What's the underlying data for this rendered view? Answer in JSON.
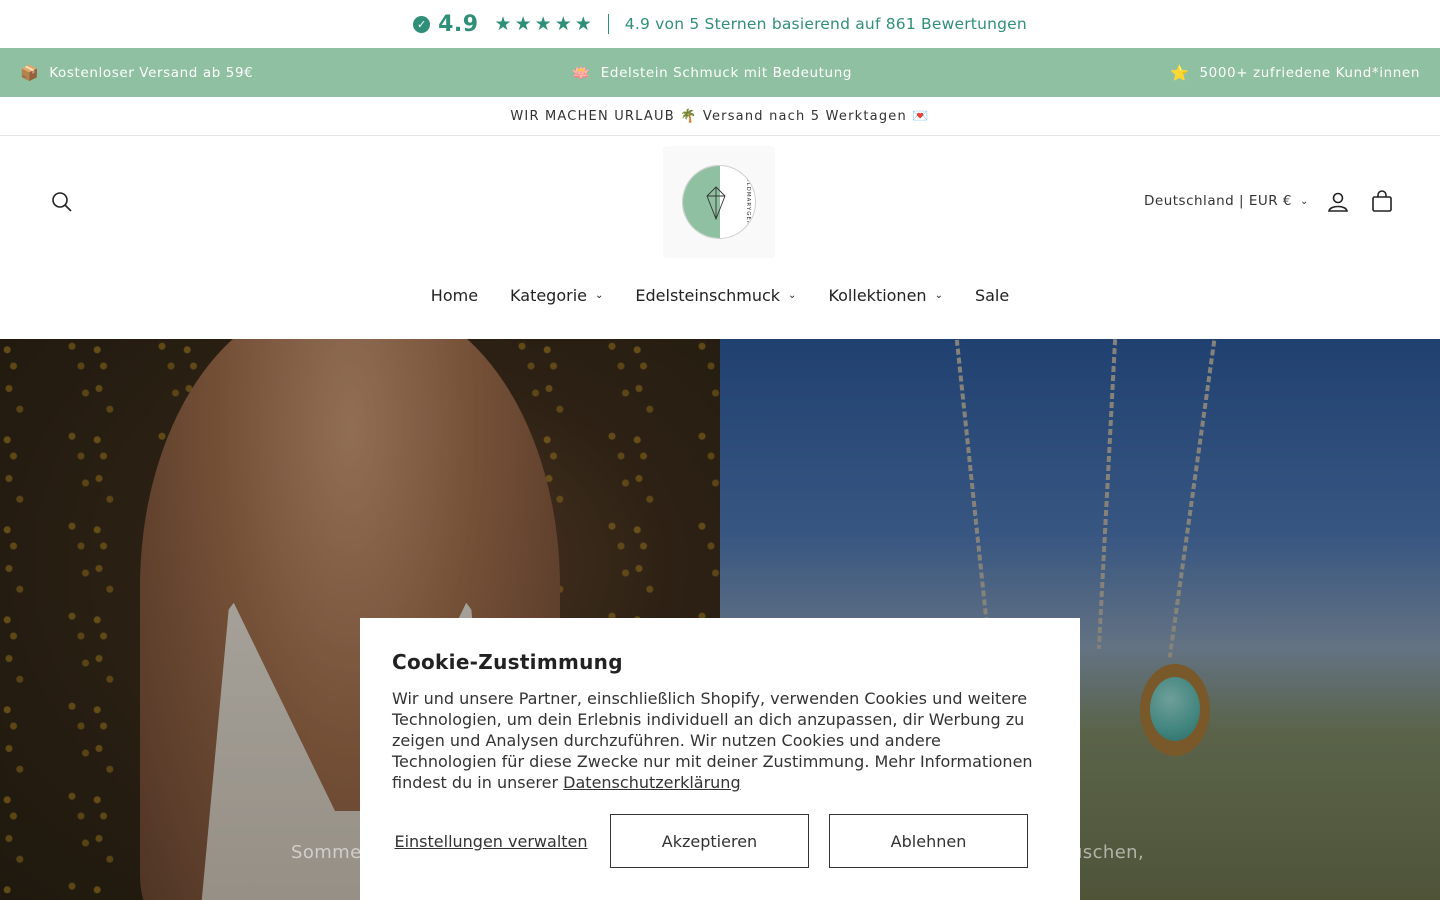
{
  "reviews": {
    "score": "4.9",
    "stars": [
      "★",
      "★",
      "★",
      "★",
      "★"
    ],
    "text": "4.9 von 5 Sternen basierend auf 861 Bewertungen"
  },
  "announcement": {
    "items": [
      {
        "emoji": "📦",
        "text": "Kostenloser Versand ab 59€"
      },
      {
        "emoji": "🪷",
        "text": "Edelstein Schmuck mit Bedeutung"
      },
      {
        "emoji": "⭐",
        "text": "5000+ zufriedene Kund*innen"
      }
    ]
  },
  "vacation": {
    "text": "WIR MACHEN URLAUB 🌴 Versand nach 5 Werktagen 💌"
  },
  "header": {
    "logo_text": "GOLDMARYGEMS",
    "country": "Deutschland | EUR €"
  },
  "nav": {
    "items": [
      {
        "label": "Home"
      },
      {
        "label": "Kategorie",
        "chevron": "⌄"
      },
      {
        "label": "Edelsteinschmuck",
        "chevron": "⌄"
      },
      {
        "label": "Kollektionen",
        "chevron": "⌄"
      },
      {
        "label": "Sale"
      }
    ]
  },
  "hero": {
    "left_text": "Somme",
    "right_text": "uschen,"
  },
  "cookie": {
    "title": "Cookie-Zustimmung",
    "body": "Wir und unsere Partner, einschließlich Shopify, verwenden Cookies und weitere Technologien, um dein Erlebnis individuell an dich anzupassen, dir Werbung zu zeigen und Analysen durchzuführen. Wir nutzen Cookies und andere Technologien für diese Zwecke nur mit deiner Zustimmung. Mehr Informationen findest du in unserer ",
    "privacy_link": "Datenschutzerklärung",
    "settings_label": "Einstellungen verwalten",
    "accept_label": "Akzeptieren",
    "decline_label": "Ablehnen"
  },
  "colors": {
    "accent": "#2f8f78",
    "announce_bg": "#8fc0a1"
  }
}
